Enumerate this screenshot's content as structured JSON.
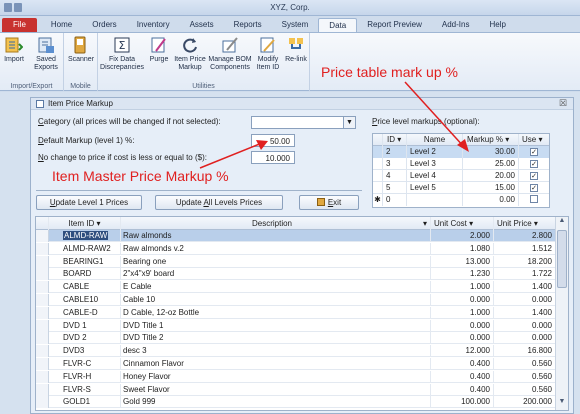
{
  "app": {
    "title": "XYZ, Corp."
  },
  "tabs": [
    "File",
    "Home",
    "Orders",
    "Inventory",
    "Assets",
    "Reports",
    "System",
    "Data",
    "Report Preview",
    "Add-Ins",
    "Help"
  ],
  "active_tab": "Data",
  "ribbon": {
    "groups": [
      {
        "label": "Import/Export",
        "buttons": [
          {
            "label": "Import",
            "icon": "import-icon"
          },
          {
            "label": "Saved Exports",
            "icon": "saved-exports-icon"
          }
        ]
      },
      {
        "label": "Mobile",
        "buttons": [
          {
            "label": "Scanner",
            "icon": "scanner-icon"
          }
        ]
      },
      {
        "label": "Utilities",
        "buttons": [
          {
            "label": "Fix Data Discrepancies",
            "icon": "fix-data-icon"
          },
          {
            "label": "Purge",
            "icon": "purge-icon"
          },
          {
            "label": "Item Price Markup",
            "icon": "price-markup-icon"
          },
          {
            "label": "Manage BOM Components",
            "icon": "manage-bom-icon"
          },
          {
            "label": "Modify Item ID",
            "icon": "modify-id-icon"
          },
          {
            "label": "Re-link",
            "icon": "relink-icon"
          }
        ]
      }
    ]
  },
  "form": {
    "title": "Item Price Markup",
    "category_label_pre": "C",
    "category_label_post": "ategory (all prices will be changed if not selected):",
    "category_value": "",
    "default_markup_label_pre": "D",
    "default_markup_label_post": "efault Markup (level 1) %:",
    "default_markup_value": "50.00",
    "no_change_label_pre": "N",
    "no_change_label_post": "o change to price if cost is less or equal to ($):",
    "no_change_value": "10.000",
    "price_level_label_pre": "P",
    "price_level_label_post": "rice level markups (optional):",
    "buttons": {
      "update_level1_pre": "U",
      "update_level1_post": "pdate Level 1 Prices",
      "update_all_pre": "Update ",
      "update_all_u": "A",
      "update_all_post": "ll Levels Prices",
      "exit_pre": "E",
      "exit_post": "xit"
    }
  },
  "price_levels": {
    "headers": [
      "ID",
      "Name",
      "Markup %",
      "Use"
    ],
    "rows": [
      {
        "id": "2",
        "name": "Level 2",
        "markup": "30.00",
        "use": true
      },
      {
        "id": "3",
        "name": "Level 3",
        "markup": "25.00",
        "use": true
      },
      {
        "id": "4",
        "name": "Level 4",
        "markup": "20.00",
        "use": true
      },
      {
        "id": "5",
        "name": "Level 5",
        "markup": "15.00",
        "use": true
      },
      {
        "id": "0",
        "name": "",
        "markup": "0.00",
        "use": false
      }
    ],
    "new_row_marker": "✱"
  },
  "items": {
    "headers": [
      "Item ID",
      "Description",
      "Unit Cost",
      "Unit Price"
    ],
    "rows": [
      [
        "ALMD-RAW",
        "Raw almonds",
        "2.000",
        "2.800"
      ],
      [
        "ALMD-RAW2",
        "Raw almonds v.2",
        "1.080",
        "1.512"
      ],
      [
        "BEARING1",
        "Bearing one",
        "13.000",
        "18.200"
      ],
      [
        "BOARD",
        "2\"x4\"x9' board",
        "1.230",
        "1.722"
      ],
      [
        "CABLE",
        "E Cable",
        "1.000",
        "1.400"
      ],
      [
        "CABLE10",
        "Cable 10",
        "0.000",
        "0.000"
      ],
      [
        "CABLE-D",
        "D Cable, 12-oz Bottle",
        "1.000",
        "1.400"
      ],
      [
        "DVD 1",
        "DVD Title 1",
        "0.000",
        "0.000"
      ],
      [
        "DVD 2",
        "DVD Title 2",
        "0.000",
        "0.000"
      ],
      [
        "DVD3",
        "desc 3",
        "12.000",
        "16.800"
      ],
      [
        "FLVR-C",
        "Cinnamon Flavor",
        "0.400",
        "0.560"
      ],
      [
        "FLVR-H",
        "Honey Flavor",
        "0.400",
        "0.560"
      ],
      [
        "FLVR-S",
        "Sweet Flavor",
        "0.400",
        "0.560"
      ],
      [
        "GOLD1",
        "Gold 999",
        "100.000",
        "200.000"
      ]
    ]
  },
  "annotations": {
    "price_table": "Price table mark up %",
    "item_master": "Item Master Price Markup %"
  },
  "colors": {
    "annotation": "#e02020",
    "file_tab": "#c8322f",
    "selection": "#b9cfea"
  }
}
